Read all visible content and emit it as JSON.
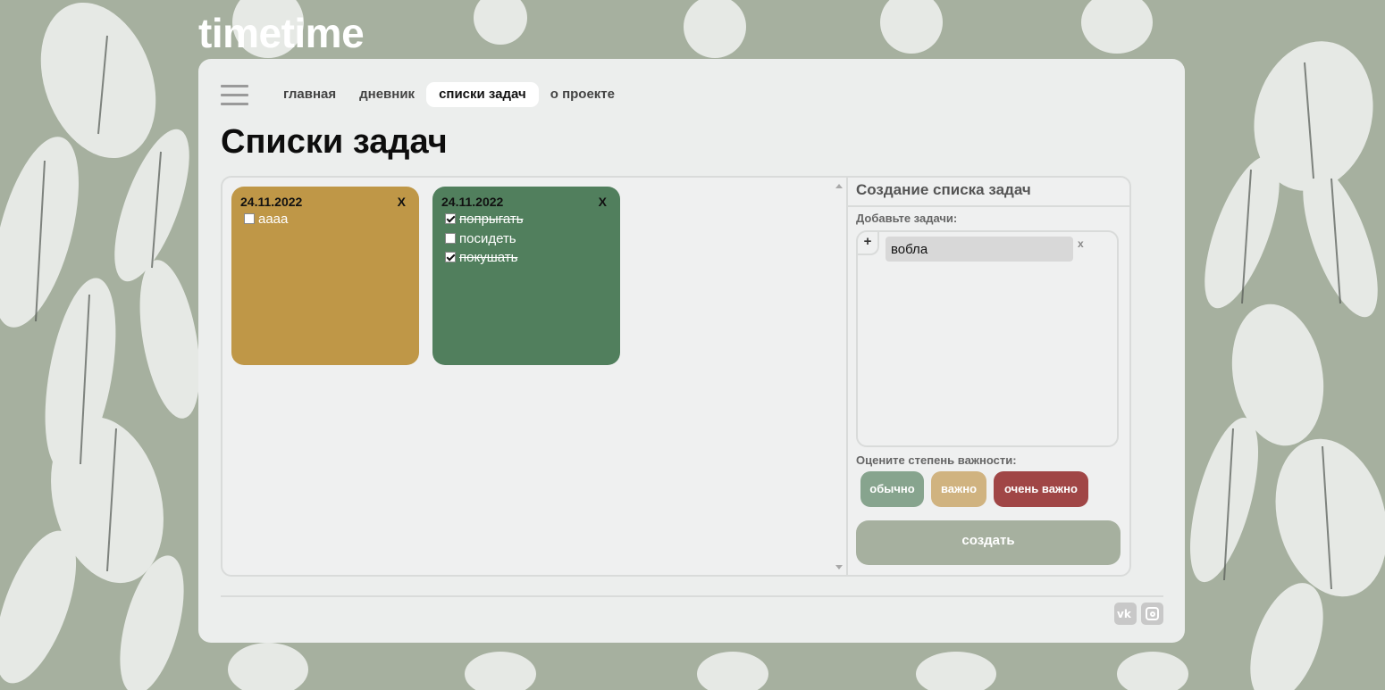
{
  "logo": "timetime",
  "nav": {
    "items": [
      "главная",
      "дневник",
      "списки задач",
      "о проекте"
    ],
    "active_index": 2
  },
  "page_title": "Списки задач",
  "task_lists": [
    {
      "date": "24.11.2022",
      "close": "X",
      "color": "#bf9747",
      "tasks": [
        {
          "text": "аааа",
          "checked": false
        }
      ]
    },
    {
      "date": "24.11.2022",
      "close": "X",
      "color": "#517f5d",
      "tasks": [
        {
          "text": "попрыгать",
          "checked": true
        },
        {
          "text": "посидеть",
          "checked": false
        },
        {
          "text": "покушать",
          "checked": true
        }
      ]
    }
  ],
  "form": {
    "title": "Создание списка задач",
    "add_tasks_label": "Добавьте задачи:",
    "add_button": "+",
    "task_input_value": "вобла",
    "task_input_remove": "x",
    "importance_label": "Оцените степень важности:",
    "importance_buttons": [
      {
        "label": "обычно",
        "color": "#87a48e"
      },
      {
        "label": "важно",
        "color": "#d0b380"
      },
      {
        "label": "очень важно",
        "color": "#a04646"
      }
    ],
    "create_button": "создать"
  },
  "social": {
    "vk_icon_text": "vk"
  },
  "colors": {
    "background": "#a6b09f",
    "card": "#eceeed",
    "accent": "#a6b09f"
  }
}
